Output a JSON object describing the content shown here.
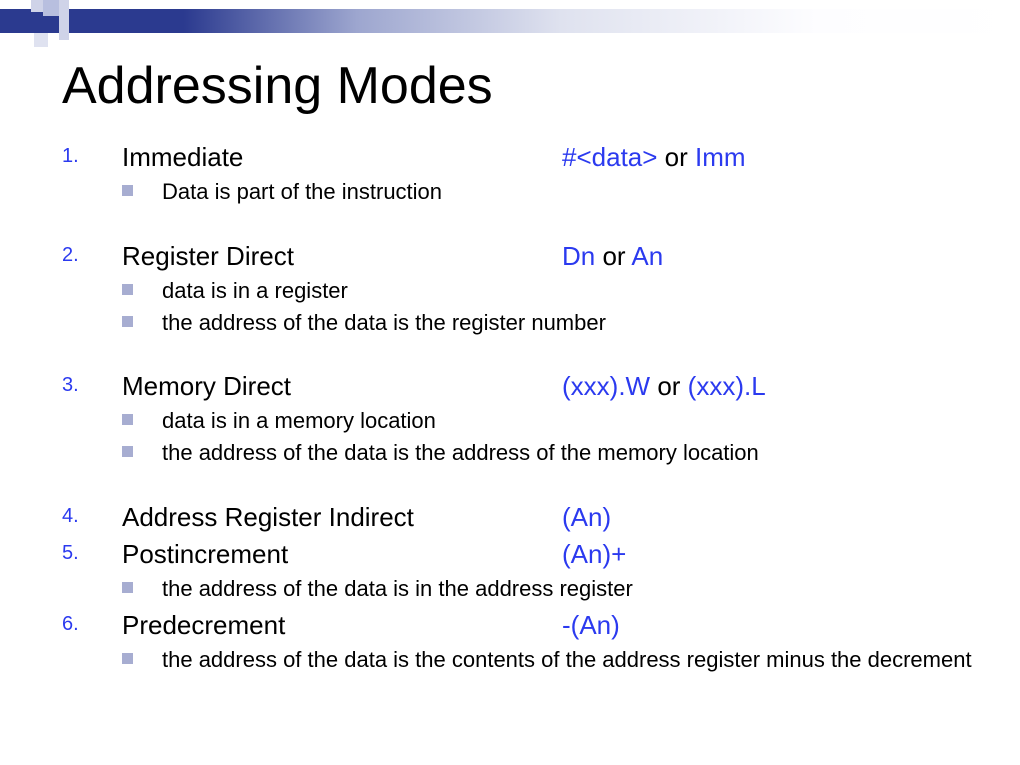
{
  "title": "Addressing Modes",
  "items": [
    {
      "num": "1.",
      "label": "Immediate",
      "syntax_parts": [
        {
          "t": "#<data>",
          "cls": "blue"
        },
        {
          "t": " or ",
          "cls": ""
        },
        {
          "t": "Imm",
          "cls": "blue"
        }
      ],
      "subs": [
        "Data is part of the instruction"
      ],
      "gap_after": true
    },
    {
      "num": "2.",
      "label": "Register Direct",
      "syntax_parts": [
        {
          "t": "Dn",
          "cls": "blue"
        },
        {
          "t": " or ",
          "cls": ""
        },
        {
          "t": "An",
          "cls": "blue"
        }
      ],
      "subs": [
        "data is in a register",
        "the address of the data is the register number"
      ],
      "gap_after": true
    },
    {
      "num": "3.",
      "label": "Memory Direct",
      "syntax_parts": [
        {
          "t": "(xxx).W",
          "cls": "blue"
        },
        {
          "t": " or ",
          "cls": ""
        },
        {
          "t": "(xxx).L",
          "cls": "blue"
        }
      ],
      "subs": [
        "data is in a memory location",
        "the address of the data is the address of the memory location"
      ],
      "gap_after": true
    },
    {
      "num": "4.",
      "label": "Address Register Indirect",
      "syntax_parts": [
        {
          "t": "(An)",
          "cls": "blue"
        }
      ],
      "subs": [],
      "gap_after": false
    },
    {
      "num": "5.",
      "label": "Postincrement",
      "syntax_parts": [
        {
          "t": "(An)+",
          "cls": "blue"
        }
      ],
      "subs": [
        "the address of the data is in the address register"
      ],
      "gap_after": false
    },
    {
      "num": "6.",
      "label": "Predecrement",
      "syntax_parts": [
        {
          "t": "-(An)",
          "cls": "blue"
        }
      ],
      "subs": [
        "the address of the data is the contents of the address register minus the decrement"
      ],
      "gap_after": false
    }
  ]
}
